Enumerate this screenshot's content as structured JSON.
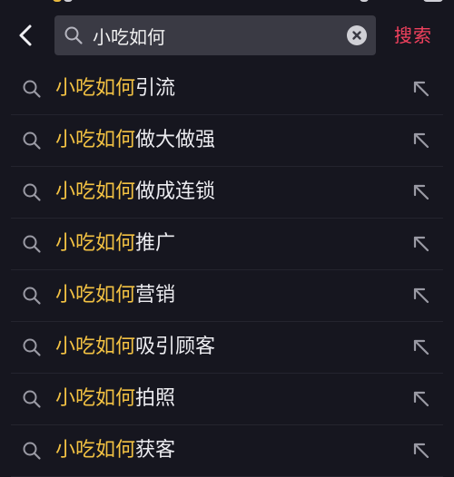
{
  "colors": {
    "background": "#16161f",
    "search_box": "#3a3a44",
    "keyword_highlight": "#f3c243",
    "suggestion_text": "#ececf0",
    "icon_gray": "#9a9aa4",
    "accent": "#f2415e"
  },
  "icons": {
    "back": "chevron-left-icon",
    "search": "search-icon",
    "clear": "clear-circle-icon",
    "fill": "arrow-up-left-icon"
  },
  "header": {
    "search": {
      "value": "小吃如何",
      "placeholder": ""
    },
    "submit_label": "搜索"
  },
  "suggestions": [
    {
      "keyword": "小吃如何",
      "suffix": "引流"
    },
    {
      "keyword": "小吃如何",
      "suffix": "做大做强"
    },
    {
      "keyword": "小吃如何",
      "suffix": "做成连锁"
    },
    {
      "keyword": "小吃如何",
      "suffix": "推广"
    },
    {
      "keyword": "小吃如何",
      "suffix": "营销"
    },
    {
      "keyword": "小吃如何",
      "suffix": "吸引顾客"
    },
    {
      "keyword": "小吃如何",
      "suffix": "拍照"
    },
    {
      "keyword": "小吃如何",
      "suffix": "获客"
    }
  ]
}
